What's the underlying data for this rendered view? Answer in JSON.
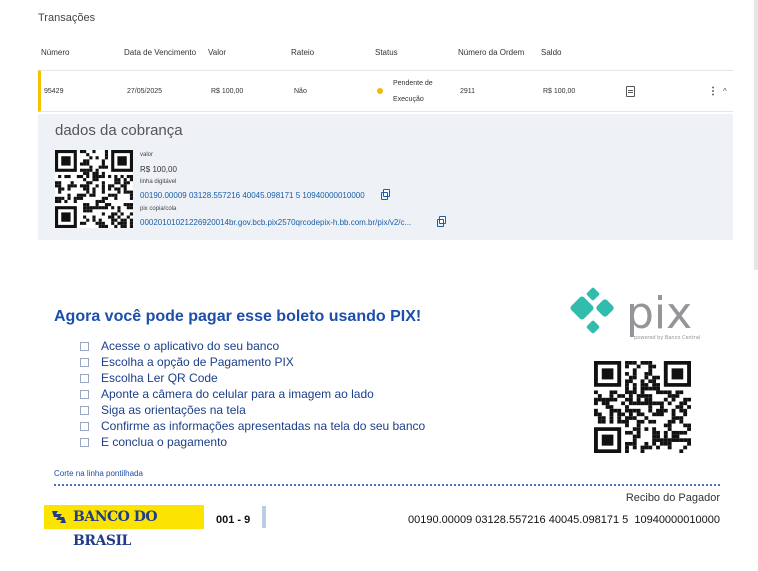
{
  "section_title": "Transações",
  "table": {
    "headers": [
      "Número",
      "Data de Vencimento",
      "Valor",
      "Rateio",
      "Status",
      "Número da Ordem",
      "Saldo"
    ],
    "rows": [
      {
        "numero": "95429",
        "vencimento": "27/05/2025",
        "valor": "R$ 100,00",
        "rateio": "Não",
        "status_line1": "Pendente de",
        "status_line2": "Execução",
        "ordem": "2911",
        "saldo": "R$ 100,00",
        "status_color": "#f5b800"
      }
    ]
  },
  "details": {
    "title": "dados da cobrança",
    "valor_label": "valor",
    "valor": "R$ 100,00",
    "linha_label": "linha digitável",
    "linha": "00190.00009 03128.557216 40045.098171 5 10940000010000",
    "pix_label": "pix copia/cola",
    "pix": "00020101021226920014br.gov.bcb.pix2570qrcodepix-h.bb.com.br/pix/v2/c..."
  },
  "pix_section": {
    "headline": "Agora você pode pagar esse boleto usando PIX!",
    "steps": [
      "Acesse o aplicativo do seu banco",
      "Escolha a opção de Pagamento PIX",
      "Escolha Ler QR Code",
      "Aponte a câmera do celular para a imagem ao lado",
      "Siga as orientações na tela",
      "Confirme as informações apresentadas na tela do seu banco",
      "E conclua o pagamento"
    ],
    "logo_text": "pix",
    "logo_tagline": "powered by Banco Central",
    "accent": "#32bcad"
  },
  "boleto": {
    "cut_label": "Corte na linha pontilhada",
    "recibo": "Recibo do Pagador",
    "bank_name": "BANCO DO BRASIL",
    "bank_code": "001 - 9",
    "linha_digitavel": "00190.00009 03128.557216 40045.098171 5  10940000010000",
    "brand_yellow": "#fce300",
    "brand_blue": "#223c8c"
  }
}
